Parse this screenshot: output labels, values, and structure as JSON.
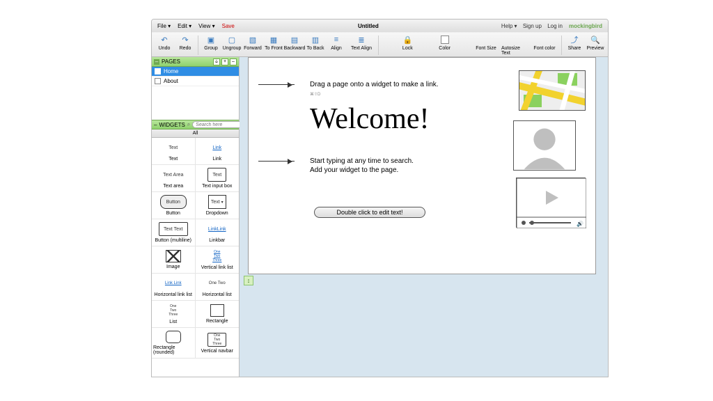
{
  "menubar": {
    "items": [
      "File ▾",
      "Edit ▾",
      "View ▾"
    ],
    "save": "Save",
    "title": "Untitled",
    "help": "Help ▾",
    "signup": "Sign up",
    "login": "Log in",
    "brand": "mockingbird"
  },
  "toolbar": {
    "undo": "Undo",
    "redo": "Redo",
    "group": "Group",
    "ungroup": "Ungroup",
    "forward": "Forward",
    "tofront": "To Front",
    "backward": "Backward",
    "toback": "To Back",
    "align": "Align",
    "textalign": "Text Align",
    "lock": "Lock",
    "color": "Color",
    "fontsize": "Font Size",
    "autosize": "Autosize Text",
    "fontcolor": "Font color",
    "share": "Share",
    "preview": "Preview"
  },
  "pages_panel": {
    "title": "PAGES",
    "add": "+",
    "del": "–"
  },
  "pages": [
    {
      "name": "Home",
      "selected": true
    },
    {
      "name": "About",
      "selected": false
    }
  ],
  "widgets_panel": {
    "title": "WIDGETS",
    "search_placeholder": "Search here",
    "tab": "All"
  },
  "widgets": [
    [
      {
        "label": "Text",
        "preview": "Text",
        "style": "plain"
      },
      {
        "label": "Link",
        "preview": "Link",
        "style": "link"
      }
    ],
    [
      {
        "label": "Text area",
        "preview": "Text\nArea",
        "style": "plain"
      },
      {
        "label": "Text input box",
        "preview": "Text",
        "style": "box"
      }
    ],
    [
      {
        "label": "Button",
        "preview": "Button",
        "style": "pill"
      },
      {
        "label": "Dropdown",
        "preview": "Text",
        "style": "dd"
      }
    ],
    [
      {
        "label": "Button (multiline)",
        "preview": "Text\nText",
        "style": "box"
      },
      {
        "label": "Linkbar",
        "preview": "LinkLink",
        "style": "link"
      }
    ],
    [
      {
        "label": "Image",
        "preview": "",
        "style": "img"
      },
      {
        "label": "Vertical link list",
        "preview": "One\nTwo\nThree",
        "style": "stack link"
      }
    ],
    [
      {
        "label": "Horizontal link list",
        "preview": "Link Link",
        "style": "hl link"
      },
      {
        "label": "Horizontal list",
        "preview": "One Two",
        "style": "hl"
      }
    ],
    [
      {
        "label": "List",
        "preview": "One\nTwo\nThree",
        "style": "stack"
      },
      {
        "label": "Rectangle",
        "preview": "",
        "style": "rect"
      }
    ],
    [
      {
        "label": "Rectangle (rounded)",
        "preview": "",
        "style": "rrect"
      },
      {
        "label": "Vertical navbar",
        "preview": "One\nTwo\nThree",
        "style": "box stack"
      }
    ]
  ],
  "canvas": {
    "hint1": "Drag a page onto a widget to make a link.",
    "hint1_sub": "⌘⇧D",
    "welcome": "Welcome!",
    "hint2a": "Start typing at any time to search.",
    "hint2b": "Add your widget to the page.",
    "dblclick": "Double click to edit text!"
  }
}
